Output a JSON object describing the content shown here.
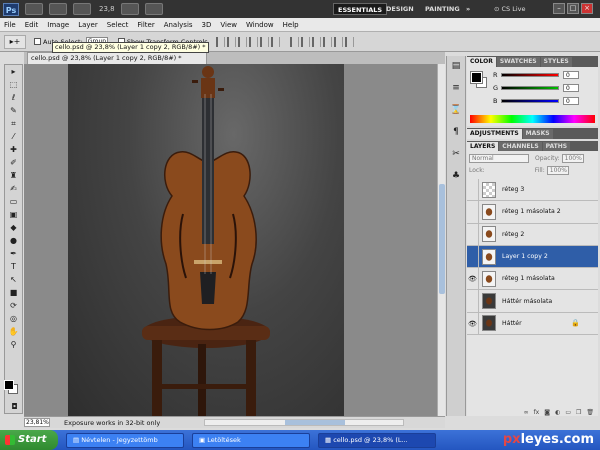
{
  "app": {
    "logo_text": "Ps",
    "zoom_display": "23,8",
    "workspaces": [
      "ESSENTIALS",
      "DESIGN",
      "PAINTING"
    ],
    "overflow": "»",
    "cs_live": "CS Live"
  },
  "menu": [
    "File",
    "Edit",
    "Image",
    "Layer",
    "Select",
    "Filter",
    "Analysis",
    "3D",
    "View",
    "Window",
    "Help"
  ],
  "options": {
    "auto_select_label": "Auto-Select:",
    "auto_select_value": "Group",
    "show_transform_label": "Show Transform Controls"
  },
  "tooltip": "cello.psd @ 23,8% (Layer 1 copy 2, RGB/8#) *",
  "document": {
    "tab_title": "cello.psd @ 23,8% (Layer 1 copy 2, RGB/8#) *"
  },
  "status": {
    "zoom": "23,81%",
    "message": "Exposure works in 32-bit only"
  },
  "color_panel": {
    "tabs": [
      "COLOR",
      "SWATCHES",
      "STYLES"
    ],
    "sliders": [
      {
        "label": "R",
        "value": "0",
        "color": "#ff0000"
      },
      {
        "label": "G",
        "value": "0",
        "color": "#00c000"
      },
      {
        "label": "B",
        "value": "0",
        "color": "#0000ff"
      }
    ]
  },
  "adjust_tabs": [
    "ADJUSTMENTS",
    "MASKS"
  ],
  "layers_panel": {
    "tabs": [
      "LAYERS",
      "CHANNELS",
      "PATHS"
    ],
    "blend_mode": "Normal",
    "opacity_label": "Opacity:",
    "opacity_value": "100%",
    "lock_label": "Lock:",
    "fill_label": "Fill:",
    "fill_value": "100%",
    "layers": [
      {
        "name": "réteg 3",
        "visible": false,
        "selected": false
      },
      {
        "name": "réteg 1 másolata 2",
        "visible": false,
        "selected": false
      },
      {
        "name": "réteg 2",
        "visible": false,
        "selected": false
      },
      {
        "name": "Layer 1 copy 2",
        "visible": false,
        "selected": true
      },
      {
        "name": "réteg 1 másolata",
        "visible": true,
        "selected": false
      },
      {
        "name": "Háttér másolata",
        "visible": false,
        "selected": false
      },
      {
        "name": "Háttér",
        "visible": true,
        "selected": false
      }
    ]
  },
  "taskbar": {
    "start": "Start",
    "tasks": [
      "Névtelen - Jegyzettömb",
      "Letöltések",
      "cello.psd @ 23,8% (L..."
    ],
    "watermark_x": "px",
    "watermark_rest": "leyes.com"
  }
}
